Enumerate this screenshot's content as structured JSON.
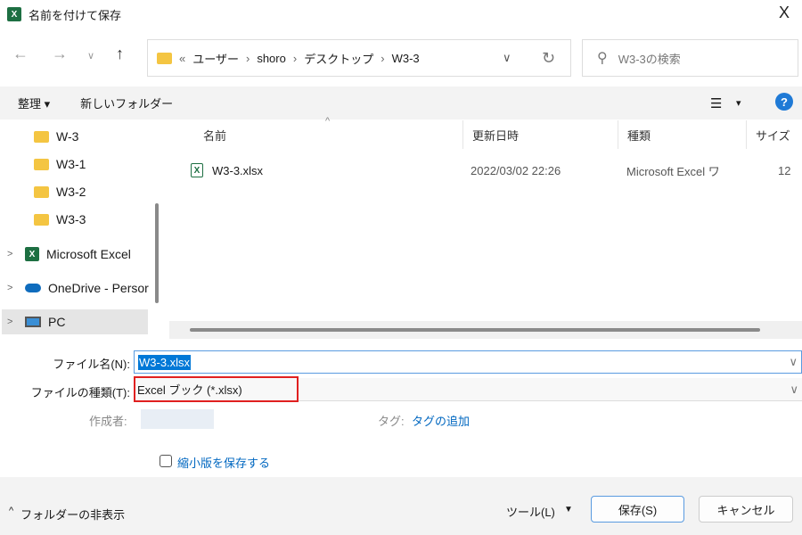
{
  "window": {
    "title": "名前を付けて保存",
    "close": "X"
  },
  "nav": {
    "back": "←",
    "forward": "→",
    "recent": "∨",
    "up": "↑"
  },
  "address": {
    "overflow": "«",
    "crumbs": [
      "ユーザー",
      "shoro",
      "デスクトップ",
      "W3-3"
    ],
    "separator": "›",
    "dropdown": "∨",
    "refresh": "↻"
  },
  "search": {
    "placeholder": "W3-3の検索",
    "icon": "⚲"
  },
  "toolbar": {
    "organize": "整理 ▾",
    "new_folder": "新しいフォルダー",
    "view": "☰",
    "view_arrow": "▾",
    "help": "?"
  },
  "tree": [
    {
      "label": "W-3",
      "icon": "folder-icon"
    },
    {
      "label": "W3-1",
      "icon": "folder-icon"
    },
    {
      "label": "W3-2",
      "icon": "folder-icon"
    },
    {
      "label": "W3-3",
      "icon": "folder-icon"
    },
    {
      "label": "Microsoft Excel",
      "icon": "excel-icon"
    },
    {
      "label": "OneDrive - Persor",
      "icon": "cloud-icon"
    },
    {
      "label": "PC",
      "icon": "pc-icon"
    }
  ],
  "columns": [
    "名前",
    "更新日時",
    "種類",
    "サイズ"
  ],
  "sort_indicator": "^",
  "files": [
    {
      "name": "W3-3.xlsx",
      "modified": "2022/03/02 22:26",
      "type": "Microsoft Excel ワ",
      "size": "12"
    }
  ],
  "form": {
    "filename_label": "ファイル名(N):",
    "filename_value": "W3-3.xlsx",
    "filetype_label": "ファイルの種類(T):",
    "filetype_value": "Excel ブック (*.xlsx)",
    "author_label": "作成者:",
    "tags_label": "タグ:",
    "tags_link": "タグの追加",
    "thumbnail_label": "縮小版を保存する",
    "chevron": "∨"
  },
  "footer": {
    "hide_folders": "フォルダーの非表示",
    "tools": "ツール(L)",
    "tools_arrow": "▼",
    "save": "保存(S)",
    "cancel": "キャンセル"
  },
  "colors": {
    "accent": "#0067c0",
    "highlight": "#e81123",
    "selection": "#0078d7"
  }
}
